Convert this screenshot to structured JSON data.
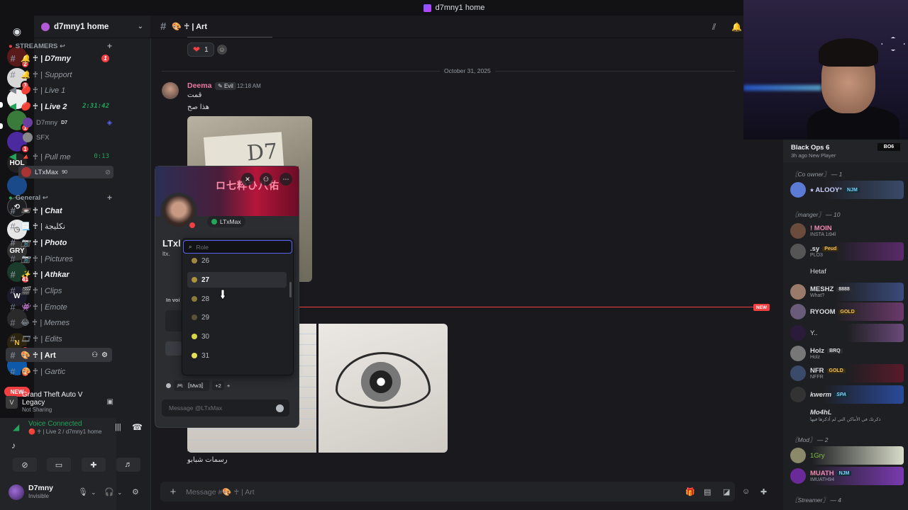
{
  "window": {
    "title": "d7mny1 home"
  },
  "guild": {
    "name": "d7mny1 home"
  },
  "rail": {
    "servers": [
      {
        "name": "discord-home",
        "badge": ""
      },
      {
        "name": "server-1",
        "badge": "2"
      },
      {
        "name": "server-2",
        "badge": "3"
      },
      {
        "name": "server-3",
        "badge": ""
      },
      {
        "name": "server-4",
        "badge": "1"
      },
      {
        "name": "server-5",
        "badge": "1"
      },
      {
        "name": "server-6",
        "badge": "2"
      },
      {
        "name": "server-7",
        "badge": ""
      },
      {
        "name": "server-8",
        "badge": ""
      },
      {
        "name": "server-9",
        "badge": ""
      },
      {
        "name": "server-10",
        "badge": ""
      },
      {
        "name": "server-11",
        "badge": "41"
      },
      {
        "name": "server-12",
        "badge": ""
      },
      {
        "name": "server-13",
        "badge": ""
      },
      {
        "name": "server-14",
        "badge": "3"
      },
      {
        "name": "server-15",
        "badge": "4"
      }
    ],
    "new_label": "NEW"
  },
  "sidebar": {
    "categories": [
      {
        "label": "STREAMERS ↩"
      },
      {
        "label": "General ↩"
      }
    ],
    "channels": [
      {
        "label": "🔔 ♰ | D7mny",
        "badge": "1"
      },
      {
        "label": "🔔 ♰ | Support"
      },
      {
        "label": "🔴 ♰ | Live 1"
      },
      {
        "label": "🔴 ♰ | Live 2",
        "timer": "2:31:42"
      },
      {
        "label": "🔺 ♰ | Pull me",
        "timer": "0:13"
      },
      {
        "label": "📼 ♰ | Chat"
      },
      {
        "label": "📃 ♰ | نكليجة"
      },
      {
        "label": "📷 ♰ | Photo"
      },
      {
        "label": "📷 ♰ | Pictures"
      },
      {
        "label": "✨ ♰ | Athkar"
      },
      {
        "label": "🎬 ♰ | Clips"
      },
      {
        "label": "👾 ♰ | Emote"
      },
      {
        "label": "😂 ♰ | Memes"
      },
      {
        "label": "🎞 ♰ | Edits"
      },
      {
        "label": "🎨 ♰ | Art"
      },
      {
        "label": "🎨 ♰ | Gartic"
      }
    ],
    "voice_users": [
      {
        "name": "D7mny",
        "tag": "D7"
      },
      {
        "name": "SFX"
      },
      {
        "name": "LTxMax",
        "tag": "90"
      }
    ]
  },
  "activity": {
    "game": "Grand Theft Auto V Legacy",
    "sharing": "Not Sharing",
    "voice_status": "Voice Connected",
    "voice_channel": "🔴 ♰ | Live 2 / d7mny1 home"
  },
  "user": {
    "name": "D7mny",
    "status": "Invisible"
  },
  "channel": {
    "name": "🎨 ♰ | Art"
  },
  "messages": {
    "reaction_count": "1",
    "date_divider": "October 31, 2025",
    "author": "Deema",
    "author_tag": "Evil",
    "time": "12:18 AM",
    "line1": "قمت",
    "line2": "هذا صح",
    "caption": "رسمات شبابو",
    "new_label": "NEW"
  },
  "composer": {
    "placeholder": "Message #🎨 ♰ | Art"
  },
  "popout": {
    "banner_text": "ロ七粋ひ八佑",
    "tag_name": "LTxMax",
    "name": "LTxl",
    "handle": "ltx.",
    "in_voice": "In voi",
    "roles": [
      "🎮 〚Mw3〛",
      "+2",
      "+"
    ],
    "message_placeholder": "Message @LTxMax"
  },
  "role_dropdown": {
    "placeholder": "Role",
    "items": [
      {
        "label": "26",
        "color": "#a0883c"
      },
      {
        "label": "27",
        "color": "#b09238"
      },
      {
        "label": "28",
        "color": "#8a7a3a"
      },
      {
        "label": "29",
        "color": "#5a5236"
      },
      {
        "label": "30",
        "color": "#d6d64a"
      },
      {
        "label": "31",
        "color": "#e0e05a"
      }
    ]
  },
  "members": {
    "now_playing": {
      "game": "Black Ops 6",
      "sub": "3h ago  New Player",
      "logo": "BO6"
    },
    "groups": [
      {
        "label": "〖Co owner〗 — 1"
      },
      {
        "label": "〖manger〗 — 10"
      },
      {
        "label": "〖Mod〗 — 2"
      },
      {
        "label": "〖Streamer〗 — 4"
      }
    ],
    "list": [
      {
        "name": "⭑ ALOOY°",
        "tag": "NJM",
        "sub": "",
        "color": "#c9d2ff"
      },
      {
        "name": "! MOIN",
        "tag": "",
        "sub": "INSTA 1i94l",
        "color": "#f08ab0"
      },
      {
        "name": ".sy",
        "tag": "Peud",
        "sub": "PLO3",
        "color": "#dbdee1"
      },
      {
        "name": "Hetaf",
        "tag": "",
        "sub": "",
        "color": "#dbdee1"
      },
      {
        "name": "MESHZ",
        "tag": "8888",
        "sub": "What?",
        "color": "#dbdee1"
      },
      {
        "name": "RYOOM",
        "tag": "GOLD",
        "sub": "",
        "color": "#dbdee1"
      },
      {
        "name": "Y..",
        "tag": "",
        "sub": "",
        "color": "#dbdee1"
      },
      {
        "name": "Holz",
        "tag": "BRQ",
        "sub": "Holz",
        "color": "#dbdee1"
      },
      {
        "name": "NFR",
        "tag": "GOLD",
        "sub": "NFFR",
        "color": "#dbdee1"
      },
      {
        "name": "kwerm",
        "tag": "SPA",
        "sub": "",
        "color": "#dbdee1"
      },
      {
        "name": "Mo4hL",
        "tag": "",
        "sub": "ذكرتك في الأماكن التي لم أذكرها فيها",
        "color": "#dbdee1"
      },
      {
        "name": "1Gry",
        "tag": "",
        "sub": "",
        "color": "#7fbf3f"
      },
      {
        "name": "MUATH",
        "tag": "NJM",
        "sub": "IMUATH94",
        "color": "#f08ab0"
      }
    ]
  }
}
